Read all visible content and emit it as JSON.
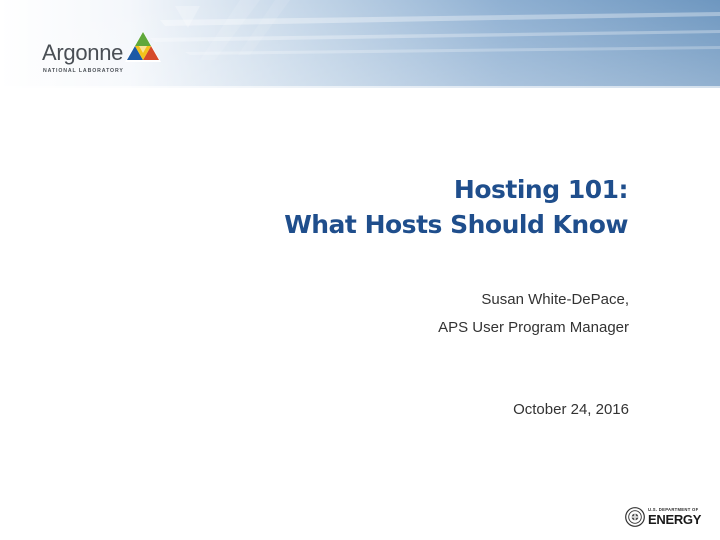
{
  "slide": {
    "title_line1": "Hosting 101:",
    "title_line2": "What Hosts Should Know",
    "presenter_name": "Susan White-DePace,",
    "presenter_role": "APS User Program Manager",
    "date": "October 24, 2016"
  },
  "logos": {
    "argonne_word": "Argonne",
    "argonne_sub": "NATIONAL LABORATORY",
    "doe_small": "U.S. DEPARTMENT OF",
    "doe_big": "ENERGY"
  },
  "colors": {
    "title": "#1f4e8c",
    "banner_dark": "#6e97c0",
    "banner_light": "#eaf1f8",
    "footer": "#7aa3cc"
  }
}
